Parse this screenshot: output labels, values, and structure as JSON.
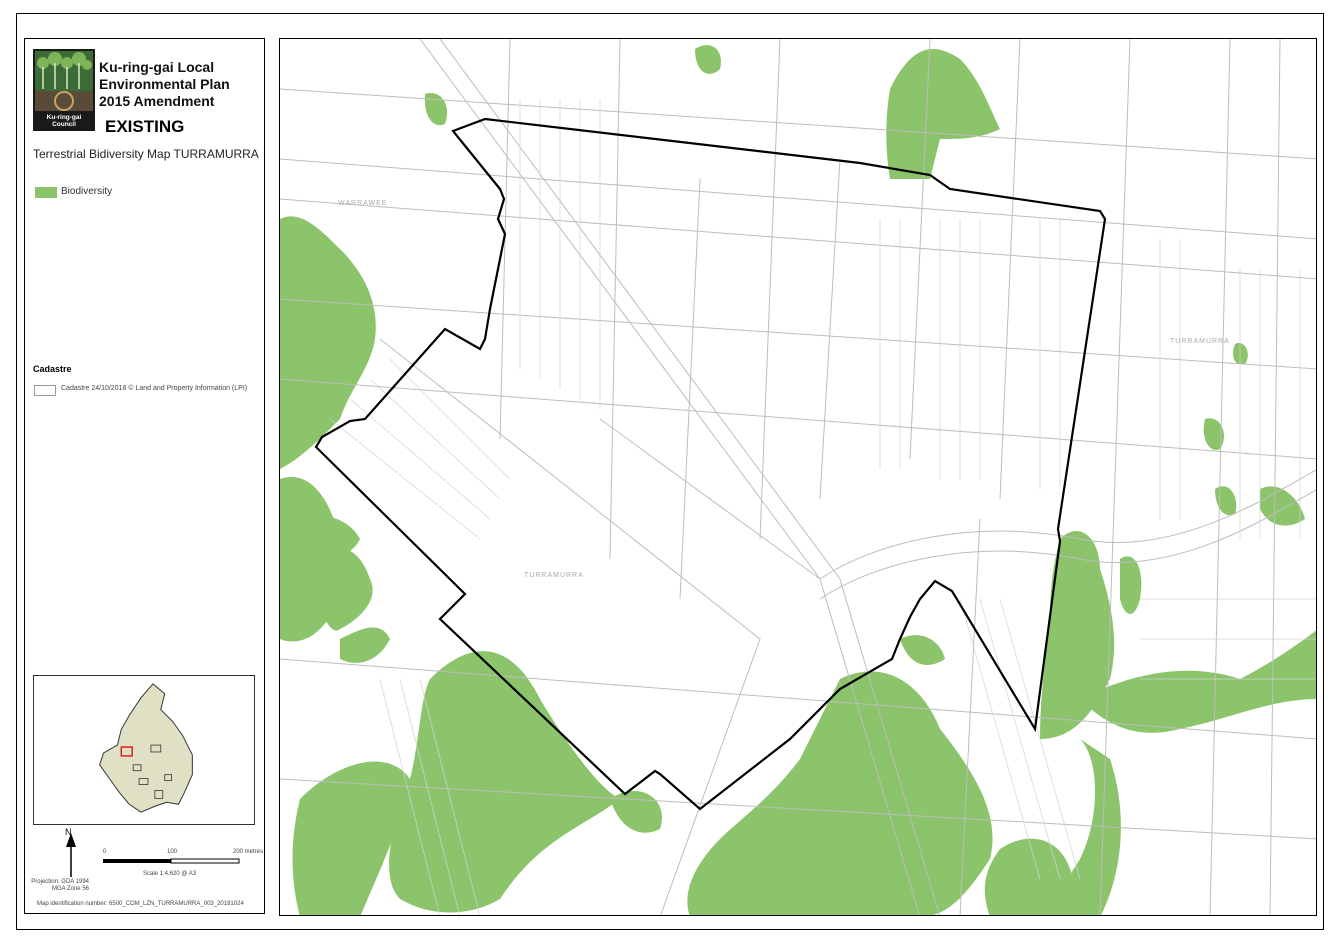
{
  "legend": {
    "title_lines": [
      "Ku-ring-gai Local",
      "Environmental Plan",
      "2015 Amendment"
    ],
    "status": "EXISTING",
    "subtitle": "Terrestrial Bidiversity Map TURRAMURRA",
    "logo_text": "Ku-ring-gai Council",
    "biodiversity_label": "Biodiversity",
    "biodiversity_color": "#8cc46c",
    "cadastre_heading": "Cadastre",
    "cadastre_label": "Cadastre 24/10/2018 © Land and Property Information (LPI)",
    "north": "N",
    "projection": "Projection: GDA 1994 MGA Zone 56",
    "scale_ticks": [
      "0",
      "100",
      "200 metres"
    ],
    "scale": "Scale 1:4,620 @ A3",
    "map_id": "Map identification number: 6500_COM_LZN_TURRAMURRA_003_20181024"
  },
  "map": {
    "place_labels": [
      "WARRAWEE",
      "TURRAMURRA",
      "TURRAMURRA"
    ],
    "boundary_color": "#000000",
    "road_color": "#bdbdbd"
  }
}
